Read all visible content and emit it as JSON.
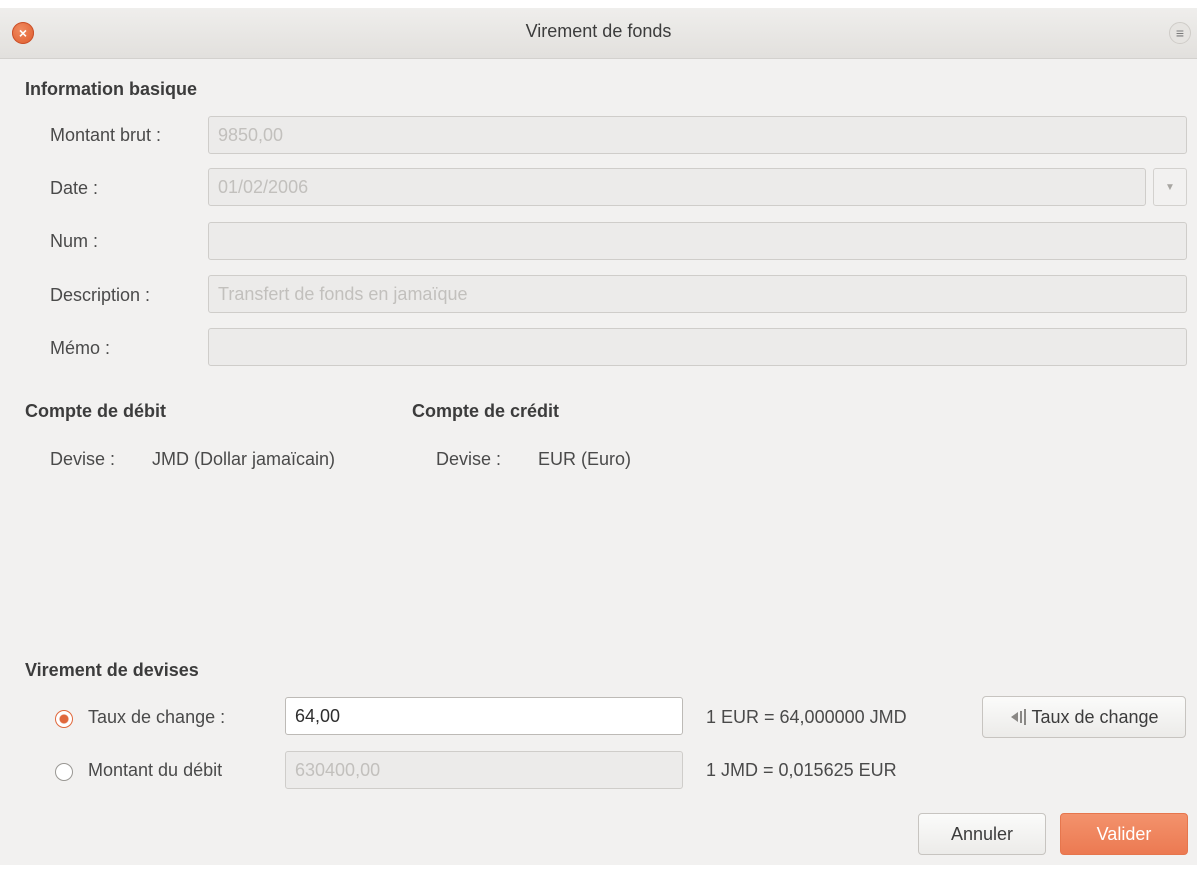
{
  "window": {
    "title": "Virement de fonds",
    "close_icon": "×",
    "menu_icon": "≡"
  },
  "basic": {
    "heading": "Information basique",
    "amount_label": "Montant brut :",
    "amount_value": "9850,00",
    "date_label": "Date :",
    "date_value": "01/02/2006",
    "date_dropdown_icon": "▼",
    "num_label": "Num :",
    "num_value": "",
    "description_label": "Description :",
    "description_placeholder": "Transfert de fonds en jamaïque",
    "memo_label": "Mémo :",
    "memo_value": ""
  },
  "debit": {
    "heading": "Compte de débit",
    "currency_label": "Devise :",
    "currency_value": "JMD (Dollar jamaïcain)"
  },
  "credit": {
    "heading": "Compte de crédit",
    "currency_label": "Devise :",
    "currency_value": "EUR (Euro)"
  },
  "transfer": {
    "heading": "Virement de devises",
    "rate_label": "Taux de change :",
    "rate_value": "64,00",
    "rate_info": "1 EUR = 64,000000 JMD",
    "rate_button": "Taux de change",
    "debit_label": "Montant du débit",
    "debit_value": "630400,00",
    "debit_info": "1 JMD = 0,015625 EUR"
  },
  "actions": {
    "cancel": "Annuler",
    "ok": "Valider"
  },
  "colors": {
    "accent": "#ec7a52",
    "window_bg": "#f2f1f0"
  }
}
